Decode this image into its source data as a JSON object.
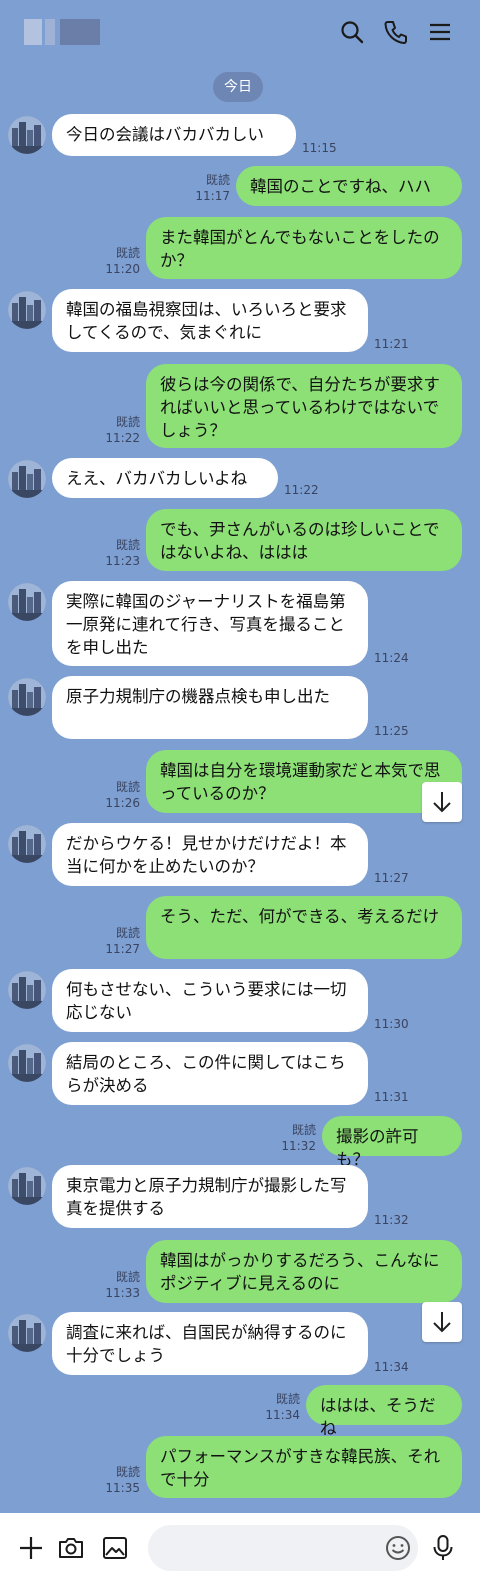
{
  "header": {
    "icons": [
      "search-icon",
      "phone-icon",
      "menu-icon"
    ]
  },
  "date_divider": "今日",
  "messages": [
    {
      "dir": "in",
      "text": "今日の会議はバカバカしい",
      "time": "11:15"
    },
    {
      "dir": "out",
      "read": "既読",
      "text": "韓国のことですね、ハハ",
      "time": "11:17"
    },
    {
      "dir": "out",
      "read": "既読",
      "text": "また韓国がとんでもないことをしたのか？",
      "time": "11:20"
    },
    {
      "dir": "in",
      "text": "韓国の福島視察団は、いろいろと要求してくるので、気まぐれに",
      "time": "11:21"
    },
    {
      "dir": "out",
      "read": "既読",
      "text": "彼らは今の関係で、自分たちが要求すればいいと思っているわけではないでしょう？",
      "time": "11:22"
    },
    {
      "dir": "in",
      "text": "ええ、バカバカしいよね",
      "time": "11:22"
    },
    {
      "dir": "out",
      "read": "既読",
      "text": "でも、尹さんがいるのは珍しいことではないよね、ははは",
      "time": "11:23"
    },
    {
      "dir": "in",
      "text": "実際に韓国のジャーナリストを福島第一原発に連れて行き、写真を撮ることを申し出た",
      "time": "11:24"
    },
    {
      "dir": "in",
      "text": "原子力規制庁の機器点検も申し出た",
      "time": "11:25"
    },
    {
      "dir": "out",
      "read": "既読",
      "text": "韓国は自分を環境運動家だと本気で思っているのか？",
      "time": "11:26"
    },
    {
      "dir": "in",
      "text": "だからウケる！見せかけだけだよ！本当に何かを止めたいのか？",
      "time": "11:27"
    },
    {
      "dir": "out",
      "read": "既読",
      "text": "そう、ただ、何ができる、考えるだけ",
      "time": "11:27"
    },
    {
      "dir": "in",
      "text": "何もさせない、こういう要求には一切応じない",
      "time": "11:30"
    },
    {
      "dir": "in",
      "text": "結局のところ、この件に関してはこちらが決める",
      "time": "11:31"
    },
    {
      "dir": "out",
      "read": "既読",
      "text": "撮影の許可も？",
      "time": "11:32"
    },
    {
      "dir": "in",
      "text": "東京電力と原子力規制庁が撮影した写真を提供する",
      "time": "11:32"
    },
    {
      "dir": "out",
      "read": "既読",
      "text": "韓国はがっかりするだろう、こんなにポジティブに見えるのに",
      "time": "11:33"
    },
    {
      "dir": "in",
      "text": "調査に来れば、自国民が納得するのに十分でしょう",
      "time": "11:34"
    },
    {
      "dir": "out",
      "read": "既読",
      "text": "ははは、そうだね",
      "time": "11:34"
    },
    {
      "dir": "out",
      "read": "既読",
      "text": "パフォーマンスがすきな韓民族、それで十分",
      "time": "11:35"
    }
  ],
  "footer": {
    "icons": [
      "plus-icon",
      "camera-icon",
      "image-icon",
      "emoji-icon",
      "microphone-icon"
    ]
  }
}
